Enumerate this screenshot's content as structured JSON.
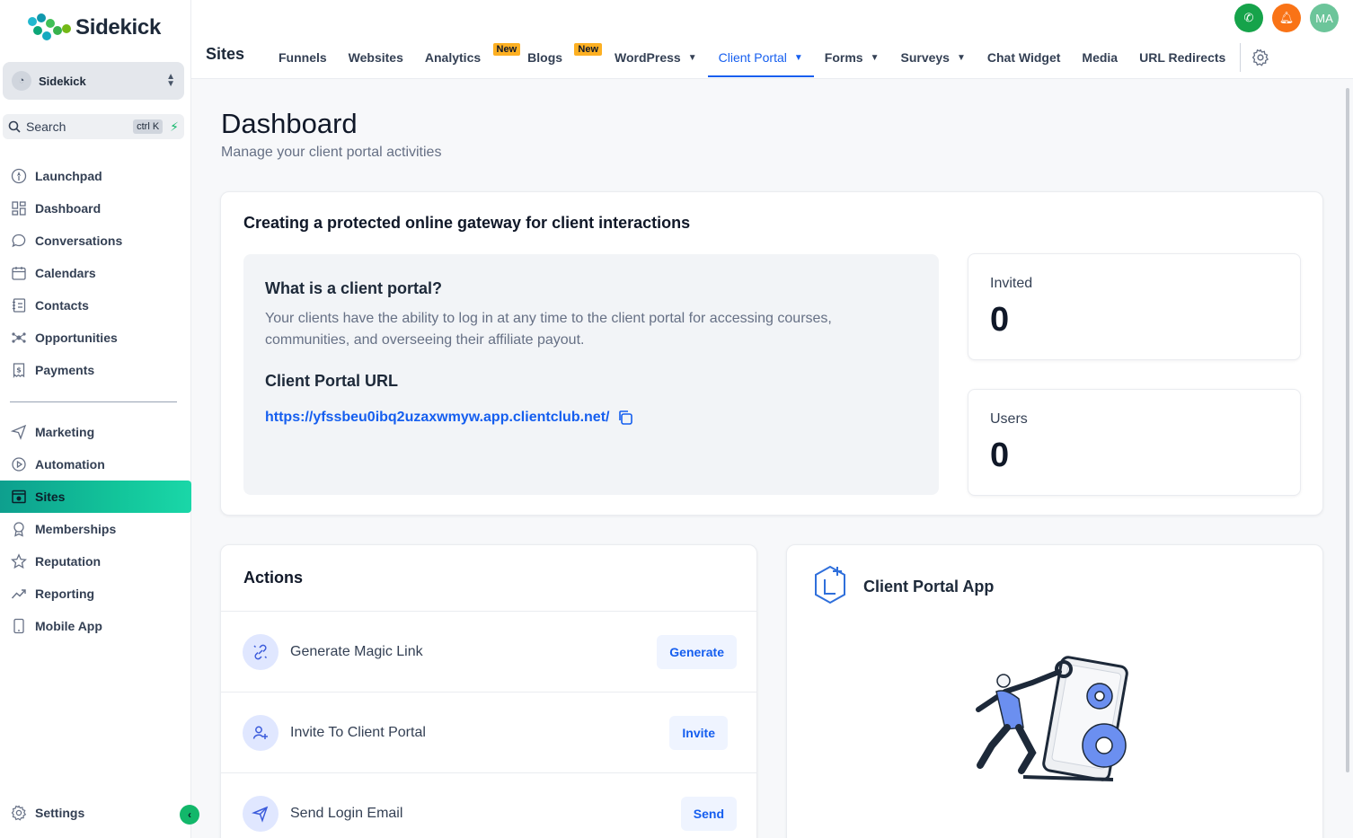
{
  "brand": {
    "name": "Sidekick"
  },
  "account": {
    "name": "Sidekick"
  },
  "search": {
    "label": "Search",
    "shortcut": "ctrl K"
  },
  "sidebar": {
    "items": [
      {
        "label": "Launchpad",
        "icon": "rocket-icon"
      },
      {
        "label": "Dashboard",
        "icon": "grid-icon"
      },
      {
        "label": "Conversations",
        "icon": "chat-icon"
      },
      {
        "label": "Calendars",
        "icon": "calendar-icon"
      },
      {
        "label": "Contacts",
        "icon": "contacts-icon"
      },
      {
        "label": "Opportunities",
        "icon": "opportunities-icon"
      },
      {
        "label": "Payments",
        "icon": "payments-icon"
      }
    ],
    "items2": [
      {
        "label": "Marketing",
        "icon": "send-icon"
      },
      {
        "label": "Automation",
        "icon": "automation-icon"
      },
      {
        "label": "Sites",
        "icon": "sites-icon",
        "active": true
      },
      {
        "label": "Memberships",
        "icon": "award-icon"
      },
      {
        "label": "Reputation",
        "icon": "star-icon"
      },
      {
        "label": "Reporting",
        "icon": "trend-icon"
      },
      {
        "label": "Mobile App",
        "icon": "mobile-icon"
      }
    ],
    "settings": "Settings"
  },
  "topbar": {
    "title": "Sites",
    "tabs": [
      {
        "label": "Funnels"
      },
      {
        "label": "Websites"
      },
      {
        "label": "Analytics",
        "badge": "New"
      },
      {
        "label": "Blogs",
        "badge": "New"
      },
      {
        "label": "WordPress",
        "dropdown": true
      },
      {
        "label": "Client Portal",
        "dropdown": true,
        "active": true
      },
      {
        "label": "Forms",
        "dropdown": true
      },
      {
        "label": "Surveys",
        "dropdown": true
      },
      {
        "label": "Chat Widget"
      },
      {
        "label": "Media"
      },
      {
        "label": "URL Redirects"
      }
    ],
    "avatar": "MA"
  },
  "page": {
    "title": "Dashboard",
    "subtitle": "Manage your client portal activities"
  },
  "overview": {
    "title": "Creating a protected online gateway for client interactions",
    "question": "What is a client portal?",
    "description": "Your clients have the ability to log in at any time to the client portal for accessing courses, communities, and overseeing their affiliate payout.",
    "url_label": "Client Portal URL",
    "url": "https://yfssbeu0ibq2uzaxwmyw.app.clientclub.net/",
    "stats": [
      {
        "label": "Invited",
        "value": "0"
      },
      {
        "label": "Users",
        "value": "0"
      }
    ]
  },
  "actions": {
    "title": "Actions",
    "rows": [
      {
        "label": "Generate Magic Link",
        "button": "Generate",
        "icon": "magic-link-icon"
      },
      {
        "label": "Invite To Client Portal",
        "button": "Invite",
        "icon": "user-plus-icon"
      },
      {
        "label": "Send Login Email",
        "button": "Send",
        "icon": "paper-plane-icon"
      }
    ]
  },
  "app_card": {
    "title": "Client Portal App"
  },
  "colors": {
    "accent": "#155eef",
    "active_gradient_start": "#0e9f8e",
    "active_gradient_end": "#1ad7a8",
    "badge": "#fdb022"
  }
}
